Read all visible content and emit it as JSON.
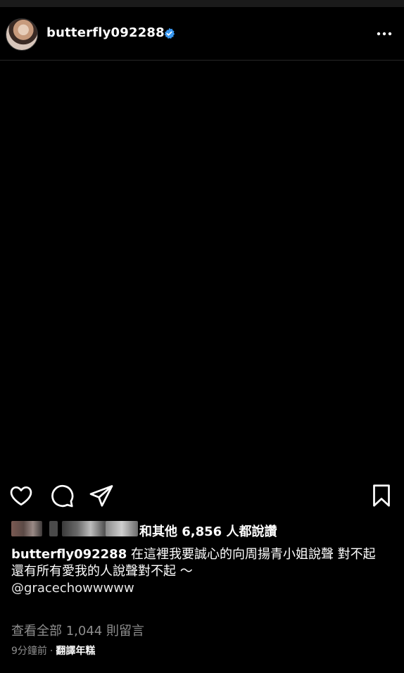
{
  "post": {
    "username": "butterfly092288",
    "verified": true,
    "verified_color": "#3897f0",
    "more_icon": "more-horizontal-icon"
  },
  "actions": {
    "like_icon": "heart-icon",
    "comment_icon": "comment-icon",
    "share_icon": "send-icon",
    "save_icon": "bookmark-icon"
  },
  "likes": {
    "text": "和其他 6,856 人都說讚"
  },
  "caption": {
    "username": "butterfly092288",
    "line1": "在這裡我要誠心的向周揚青小姐說聲 對不起",
    "line2": "還有所有愛我的人說聲對不起 ～",
    "mention": "@gracechowwwww"
  },
  "comments": {
    "view_all": "查看全部 1,044 則留言"
  },
  "meta": {
    "time": "9分鐘前",
    "separator": "·",
    "translate": "翻譯年糕"
  }
}
